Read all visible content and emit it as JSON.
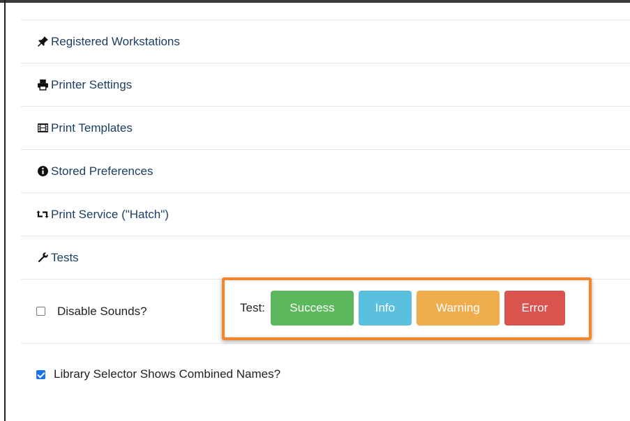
{
  "menu": [
    {
      "label": "Registered Workstations",
      "icon": "pushpin-icon"
    },
    {
      "label": "Printer Settings",
      "icon": "printer-icon"
    },
    {
      "label": "Print Templates",
      "icon": "film-icon"
    },
    {
      "label": "Stored Preferences",
      "icon": "info-circle-icon"
    },
    {
      "label": "Print Service (\"Hatch\")",
      "icon": "retweet-icon"
    },
    {
      "label": "Tests",
      "icon": "wrench-icon"
    }
  ],
  "sounds": {
    "checkbox_label": "Disable Sounds?",
    "checked": false,
    "test_label": "Test:",
    "buttons": [
      {
        "label": "Success",
        "color": "#5cb85c"
      },
      {
        "label": "Info",
        "color": "#5bc0de"
      },
      {
        "label": "Warning",
        "color": "#f0ad4e"
      },
      {
        "label": "Error",
        "color": "#d9534f"
      }
    ],
    "highlight_color": "#f5872a"
  },
  "library_selector": {
    "checkbox_label": "Library Selector Shows Combined Names?",
    "checked": true
  },
  "colors": {
    "link": "#1b3e63",
    "checkbox_checked": "#1a73e8"
  }
}
